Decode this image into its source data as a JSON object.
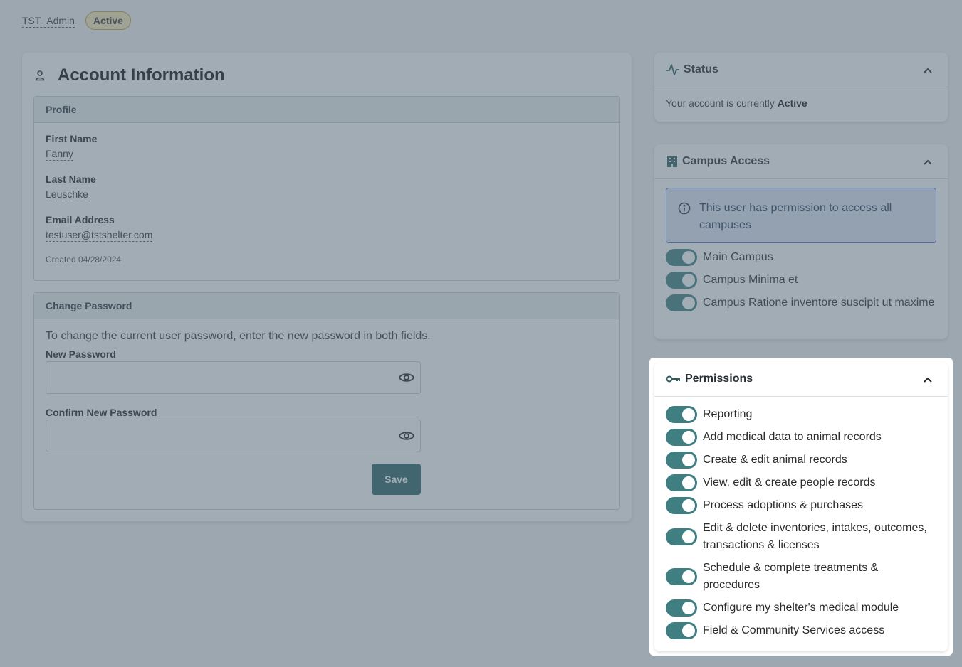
{
  "header": {
    "username": "TST_Admin",
    "status_badge": "Active"
  },
  "account": {
    "title": "Account Information",
    "profile": {
      "heading": "Profile",
      "first_name_label": "First Name",
      "first_name": "Fanny",
      "last_name_label": "Last Name",
      "last_name": "Leuschke",
      "email_label": "Email Address",
      "email": "testuser@tstshelter.com",
      "created": "Created 04/28/2024"
    },
    "password": {
      "heading": "Change Password",
      "description": "To change the current user password, enter the new password in both fields.",
      "new_label": "New Password",
      "confirm_label": "Confirm New Password",
      "save_label": "Save"
    }
  },
  "status": {
    "title": "Status",
    "text_prefix": "Your account is currently",
    "value": "Active"
  },
  "campus": {
    "title": "Campus Access",
    "info": "This user has permission to access all campuses",
    "items": [
      {
        "label": "Main Campus",
        "on": true
      },
      {
        "label": "Campus Minima et",
        "on": true
      },
      {
        "label": "Campus Ratione inventore suscipit ut maxime",
        "on": true
      }
    ]
  },
  "permissions": {
    "title": "Permissions",
    "items": [
      {
        "label": "Reporting",
        "on": true
      },
      {
        "label": "Add medical data to animal records",
        "on": true
      },
      {
        "label": "Create & edit animal records",
        "on": true
      },
      {
        "label": "View, edit & create people records",
        "on": true
      },
      {
        "label": "Process adoptions & purchases",
        "on": true
      },
      {
        "label": "Edit & delete inventories, intakes, outcomes, transactions & licenses",
        "on": true
      },
      {
        "label": "Schedule & complete treatments & procedures",
        "on": true
      },
      {
        "label": "Configure my shelter's medical module",
        "on": true
      },
      {
        "label": "Field & Community Services access",
        "on": true
      }
    ]
  },
  "colors": {
    "toggle_on": "#3f7f81",
    "primary_button": "#2e6467",
    "info_border": "#4c6ecb",
    "overlay": "#546776"
  }
}
